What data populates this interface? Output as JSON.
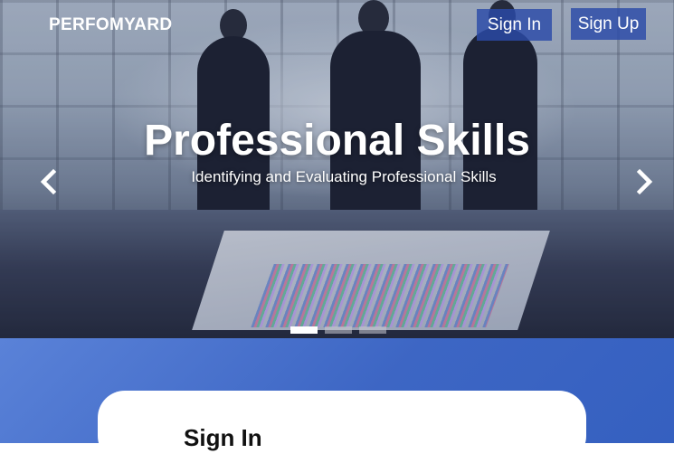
{
  "brand": "PERFOMYARD",
  "nav": {
    "signin_label": "Sign In",
    "signup_label": "Sign Up"
  },
  "carousel": {
    "title": "Professional Skills",
    "subtitle": "Identifying and Evaluating Professional Skills",
    "slide_count": 3,
    "active_slide": 1,
    "prev_icon": "chevron-left-icon",
    "next_icon": "chevron-right-icon"
  },
  "login_card": {
    "heading": "Sign In"
  },
  "colors": {
    "nav_button_bg": "#2b4aa8",
    "section_bg": "#4a72cf",
    "card_bg": "#ffffff"
  }
}
